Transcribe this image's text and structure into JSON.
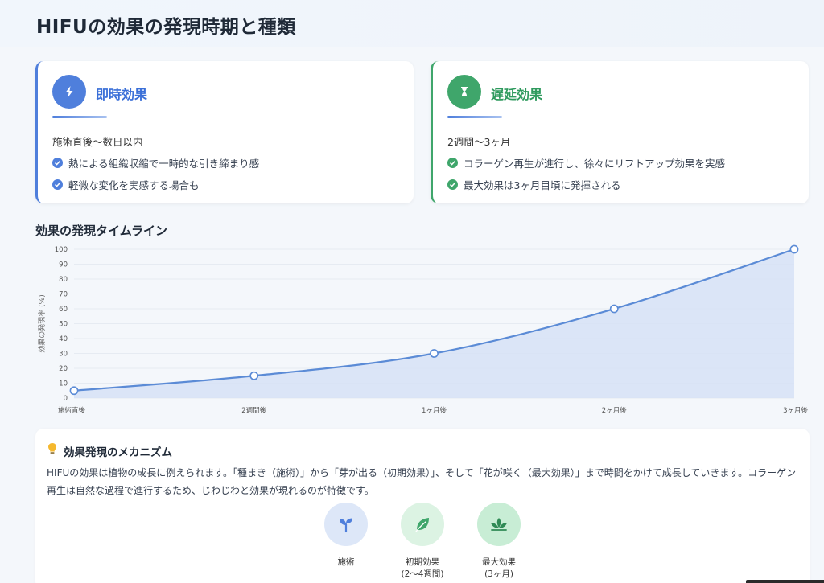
{
  "header": {
    "title": "HIFUの効果の発現時期と種類"
  },
  "cards": [
    {
      "title": "即時効果",
      "icon": "lightning-icon",
      "accent": "#4f7fdc",
      "period": "施術直後〜数日以内",
      "bullets": [
        "熱による組織収縮で一時的な引き締まり感",
        "軽微な変化を実感する場合も"
      ]
    },
    {
      "title": "遅延効果",
      "icon": "hourglass-icon",
      "accent": "#3fa66b",
      "period": "2週間〜3ヶ月",
      "bullets": [
        "コラーゲン再生が進行し、徐々にリフトアップ効果を実感",
        "最大効果は3ヶ月目頃に発揮される"
      ]
    }
  ],
  "timeline": {
    "title": "効果の発現タイムライン"
  },
  "chart_data": {
    "type": "area",
    "title": "",
    "xlabel": "",
    "ylabel": "効果の発現率 (%)",
    "categories": [
      "施術直後",
      "2週間後",
      "1ヶ月後",
      "2ヶ月後",
      "3ヶ月後"
    ],
    "series": [
      {
        "values": [
          5,
          15,
          30,
          60,
          100
        ]
      }
    ],
    "ylim": [
      0,
      100
    ],
    "yticks": [
      0,
      10,
      20,
      30,
      40,
      50,
      60,
      70,
      80,
      90,
      100
    ],
    "grid": true,
    "line_color": "#5b8bd6",
    "fill_color": "#d6e2f6"
  },
  "mechanism": {
    "title": "効果発現のメカニズム",
    "icon": "lightbulb-icon",
    "text": "HIFUの効果は植物の成長に例えられます。「種まき（施術）」から「芽が出る（初期効果）」、そして「花が咲く（最大効果）」まで時間をかけて成長していきます。コラーゲン再生は自然な過程で進行するため、じわじわと効果が現れるのが特徴です。",
    "stages": [
      {
        "label": "施術",
        "sub": "",
        "icon": "sprout-icon"
      },
      {
        "label": "初期効果",
        "sub": "(2〜4週間)",
        "icon": "leaf-icon"
      },
      {
        "label": "最大効果",
        "sub": "(3ヶ月)",
        "icon": "lotus-icon"
      }
    ]
  }
}
